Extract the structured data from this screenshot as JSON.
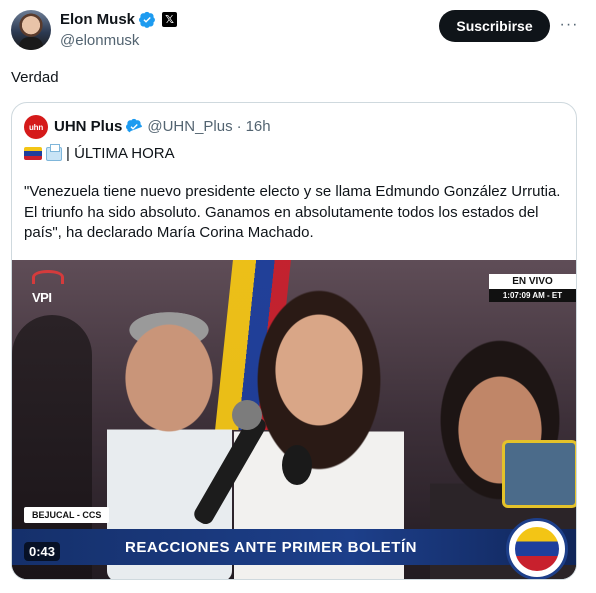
{
  "author": {
    "display_name": "Elon Musk",
    "handle": "@elonmusk",
    "affiliate_badge": "𝕏"
  },
  "actions": {
    "subscribe_label": "Suscribirse",
    "more_label": "···"
  },
  "tweet": {
    "text": "Verdad"
  },
  "quote": {
    "avatar_text": "uhn",
    "display_name": "UHN Plus",
    "handle": "@UHN_Plus",
    "separator": "·",
    "time": "16h",
    "line1": "| ÚLTIMA HORA",
    "body": "\"Venezuela tiene nuevo presidente electo y se llama Edmundo González Urrutia. El triunfo ha sido absoluto. Ganamos en absolutamente todos los estados del país\", ha declarado María Corina Machado."
  },
  "video": {
    "channel_logo": "VPI",
    "live_label": "EN VIVO",
    "live_time": "1:07:09 AM - ET",
    "location": "BEJUCAL - CCS",
    "headline": "REACCIONES ANTE PRIMER BOLETÍN",
    "duration": "0:43"
  },
  "colors": {
    "verified": "#1d9bf0",
    "subscribe_bg": "#0f1419",
    "quote_border": "#cfd9de",
    "uhn_red": "#d51a1a",
    "lower_bar": "#1d3f8a"
  }
}
